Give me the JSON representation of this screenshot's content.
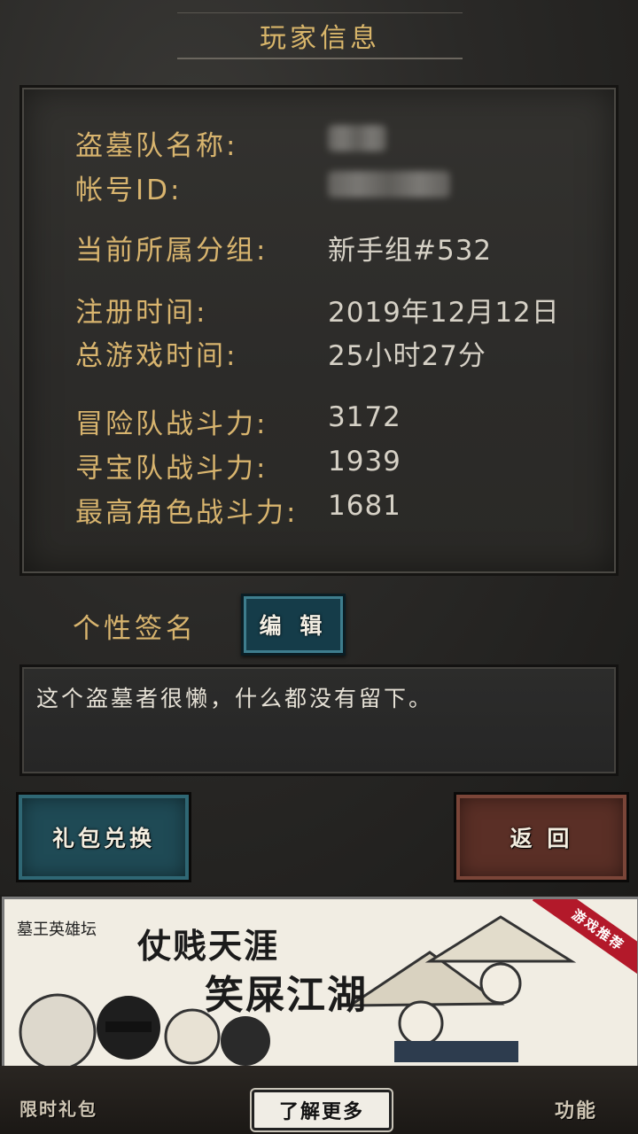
{
  "header": {
    "title": "玩家信息"
  },
  "info": {
    "team_name_label": "盗墓队名称:",
    "account_id_label": "帐号ID:",
    "group_label": "当前所属分组:",
    "group_value": "新手组#532",
    "register_label": "注册时间:",
    "register_value": "2019年12月12日",
    "playtime_label": "总游戏时间:",
    "playtime_value": "25小时27分",
    "adventure_power_label": "冒险队战斗力:",
    "adventure_power_value": "3172",
    "treasure_power_label": "寻宝队战斗力:",
    "treasure_power_value": "1939",
    "top_role_power_label": "最高角色战斗力:",
    "top_role_power_value": "1681"
  },
  "signature": {
    "label": "个性签名",
    "edit_button": "编 辑",
    "text": "这个盗墓者很懒，什么都没有留下。"
  },
  "buttons": {
    "gift_code": "礼包兑换",
    "back": "返 回"
  },
  "ad": {
    "logo": "墓王英雄坛",
    "line1": "仗贱天涯",
    "line2": "笑屎江湖",
    "ribbon": "游戏推荐"
  },
  "bottom_nav": {
    "left": "限时礼包",
    "center": "了解更多",
    "right": "功能"
  }
}
